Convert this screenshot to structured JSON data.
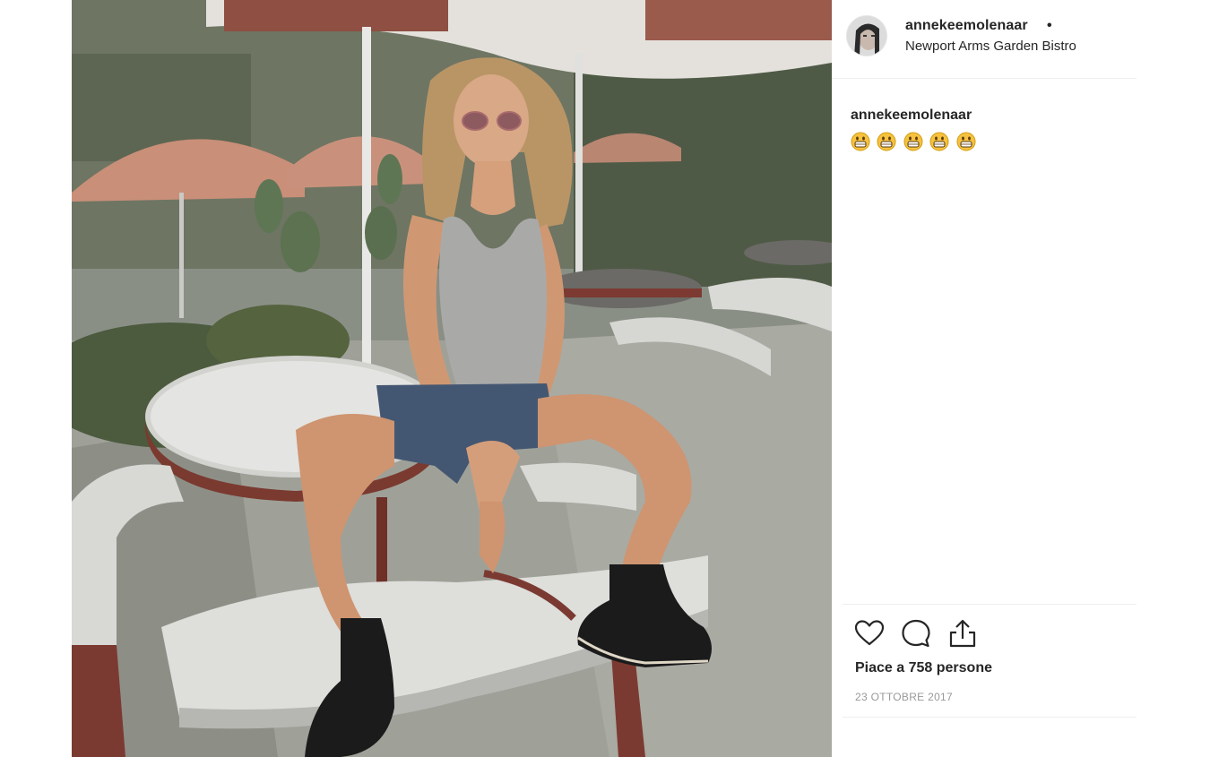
{
  "post": {
    "username": "annekeemolenaar",
    "separator": "•",
    "location": "Newport Arms Garden Bistro",
    "avatar_alt": "avatar",
    "caption_user": "annekeemolenaar",
    "caption_emojis": [
      "grinning-face-emoji",
      "grinning-face-emoji",
      "grinning-face-emoji",
      "grinning-face-emoji",
      "grinning-face-emoji"
    ],
    "likes_text": "Piace a 758 persone",
    "date_text": "23 OTTOBRE 2017"
  },
  "icons": {
    "like": "heart-icon",
    "comment": "comment-bubble-icon",
    "share": "share-upload-icon"
  },
  "colors": {
    "text": "#262626",
    "muted": "#999999",
    "divider": "#efefef",
    "emoji_yellow": "#f6c23e"
  }
}
